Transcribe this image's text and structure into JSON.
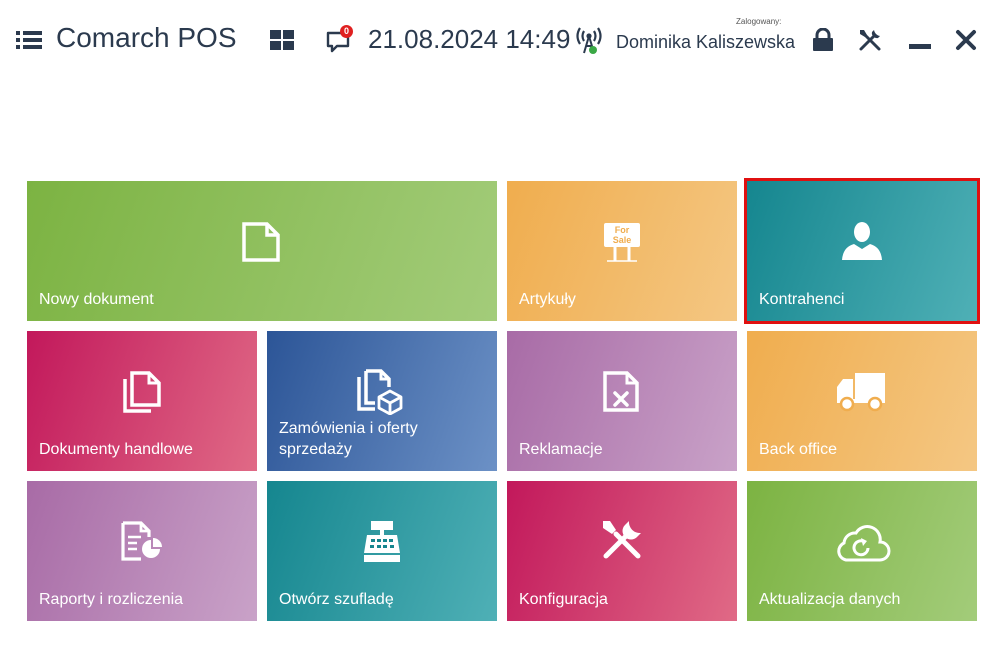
{
  "header": {
    "app_title": "Comarch POS",
    "notification_count": "0",
    "datetime": "21.08.2024 14:49",
    "logged_label": "Zalogowany:",
    "user_name": "Dominika Kaliszewska",
    "icons": [
      "menu-icon",
      "tiles-icon",
      "notification-icon",
      "connection-icon",
      "lock-icon",
      "tools-icon",
      "minimize-icon",
      "close-icon"
    ]
  },
  "tiles": [
    {
      "label": "Nowy dokument",
      "icon": "new-document-icon",
      "color": "#7cb342"
    },
    {
      "label": "Artykuły",
      "icon": "for-sale-icon",
      "icon_text_1": "For",
      "icon_text_2": "Sale",
      "color": "#f0ad4e"
    },
    {
      "label": "Kontrahenci",
      "icon": "person-icon",
      "color": "#15868f",
      "selected": true
    },
    {
      "label": "Dokumenty handlowe",
      "icon": "documents-icon",
      "color": "#c2185b"
    },
    {
      "label_line1": "Zamówienia i oferty",
      "label_line2": "sprzedaży",
      "icon": "order-documents-icon",
      "color": "#2c5597"
    },
    {
      "label": "Reklamacje",
      "icon": "complaint-icon",
      "color": "#a86ba6"
    },
    {
      "label": "Back office",
      "icon": "truck-icon",
      "color": "#f0ad4e"
    },
    {
      "label": "Raporty i rozliczenia",
      "icon": "report-icon",
      "color": "#a86ba6"
    },
    {
      "label": "Otwórz szufladę",
      "icon": "cash-register-icon",
      "color": "#15868f"
    },
    {
      "label": "Konfiguracja",
      "icon": "tools-config-icon",
      "color": "#c2185b"
    },
    {
      "label": "Aktualizacja danych",
      "icon": "cloud-refresh-icon",
      "color": "#7cb342"
    }
  ]
}
